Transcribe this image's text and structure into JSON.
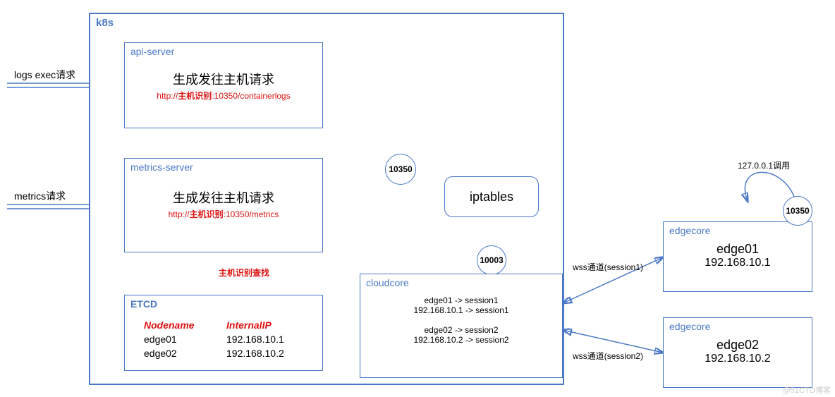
{
  "k8s": {
    "title": "k8s",
    "apiServer": {
      "title": "api-server",
      "heading": "生成发往主机请求",
      "urlPrefix": "http://",
      "urlHost": "主机识别",
      "urlSuffix": ":10350/containerlogs"
    },
    "metricsServer": {
      "title": "metrics-server",
      "heading": "生成发往主机请求",
      "urlPrefix": "http://",
      "urlHost": "主机识别",
      "urlSuffix": ":10350/metrics"
    },
    "etcd": {
      "title": "ETCD",
      "lookupLabel": "主机识别查找",
      "cols": {
        "nodename": "Nodename",
        "internalip": "InternalIP"
      },
      "rows": [
        {
          "nodename": "edge01",
          "internalip": "192.168.10.1"
        },
        {
          "nodename": "edge02",
          "internalip": "192.168.10.2"
        }
      ]
    },
    "port10350": "10350",
    "iptables": "iptables",
    "port10003": "10003",
    "cloudcore": {
      "title": "cloudcore",
      "map": {
        "l1": "edge01 -> session1",
        "l2": "192.168.10.1 -> session1",
        "l3": "edge02 -> session2",
        "l4": "192.168.10.2 -> session2"
      }
    }
  },
  "inputs": {
    "logsExec": "logs exec请求",
    "metrics": "metrics请求"
  },
  "wss": {
    "s1": "wss通道(session1)",
    "s2": "wss通道(session2)"
  },
  "edge": {
    "edgecore1": {
      "title": "edgecore",
      "name": "edge01",
      "ip": "192.168.10.1"
    },
    "edgecore2": {
      "title": "edgecore",
      "name": "edge02",
      "ip": "192.168.10.2"
    },
    "loop": "127.0.0.1调用",
    "port10350": "10350"
  },
  "watermark": "@51CTO博客"
}
